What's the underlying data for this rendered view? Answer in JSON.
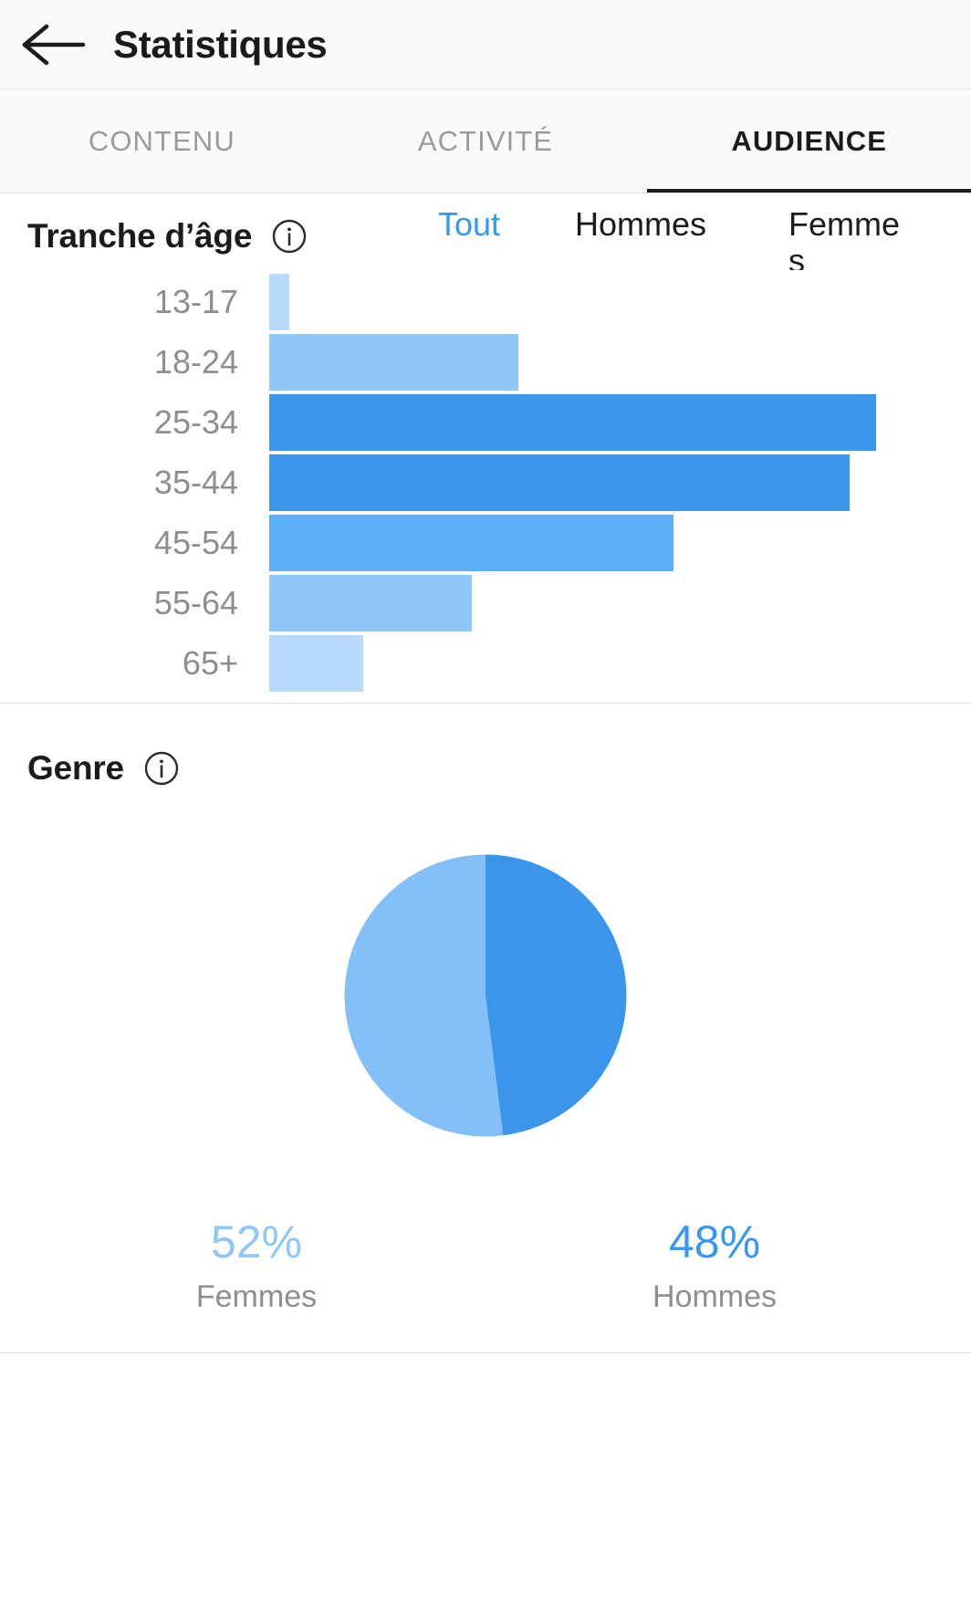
{
  "header": {
    "back_icon": "back-arrow-icon",
    "title": "Statistiques"
  },
  "tabs": [
    {
      "id": "contenu",
      "label": "CONTENU",
      "active": false
    },
    {
      "id": "activite",
      "label": "ACTIVITÉ",
      "active": false
    },
    {
      "id": "audience",
      "label": "AUDIENCE",
      "active": true
    }
  ],
  "age_section": {
    "title": "Tranche d’âge",
    "info_icon": "info-circle-icon",
    "filters": [
      {
        "id": "tout",
        "label": "Tout",
        "active": true
      },
      {
        "id": "hommes",
        "label": "Hommes",
        "active": false
      },
      {
        "id": "femmes",
        "label": "Femmes",
        "active": false
      }
    ]
  },
  "genre_section": {
    "title": "Genre",
    "info_icon": "info-circle-icon",
    "femmes_pct": "52%",
    "femmes_label": "Femmes",
    "hommes_pct": "48%",
    "hommes_label": "Hommes"
  },
  "colors": {
    "accent_blue": "#3897f0",
    "bar_dark": "#3b95ea",
    "bar_mid": "#5daef8",
    "bar_light": "#8fc7f8",
    "bar_lighter": "#b8dbfb",
    "pie_femmes": "#83c0f7",
    "pie_hommes": "#3b95ea",
    "muted_text": "#8e8e8e",
    "dark_text": "#1b1b1b",
    "header_bg": "#fafafa"
  },
  "chart_data": [
    {
      "type": "bar",
      "orientation": "horizontal",
      "title": "Tranche d’âge",
      "xlabel": "",
      "ylabel": "",
      "grid": false,
      "legend": "none",
      "categories": [
        "13-17",
        "18-24",
        "25-34",
        "35-44",
        "45-54",
        "55-64",
        "65+"
      ],
      "values": [
        3,
        37,
        90,
        86,
        60,
        30,
        14
      ],
      "xlim": [
        0,
        100
      ],
      "bar_colors": [
        "#b8dbfb",
        "#8fc7f8",
        "#3b95ea",
        "#3b95ea",
        "#5daef8",
        "#8fc7f8",
        "#b8dbfb"
      ]
    },
    {
      "type": "pie",
      "title": "Genre",
      "labels": [
        "Femmes",
        "Hommes"
      ],
      "values": [
        52,
        48
      ],
      "value_labels": [
        "52%",
        "48%"
      ],
      "colors": [
        "#83c0f7",
        "#3b95ea"
      ],
      "legend": "bottom"
    }
  ]
}
